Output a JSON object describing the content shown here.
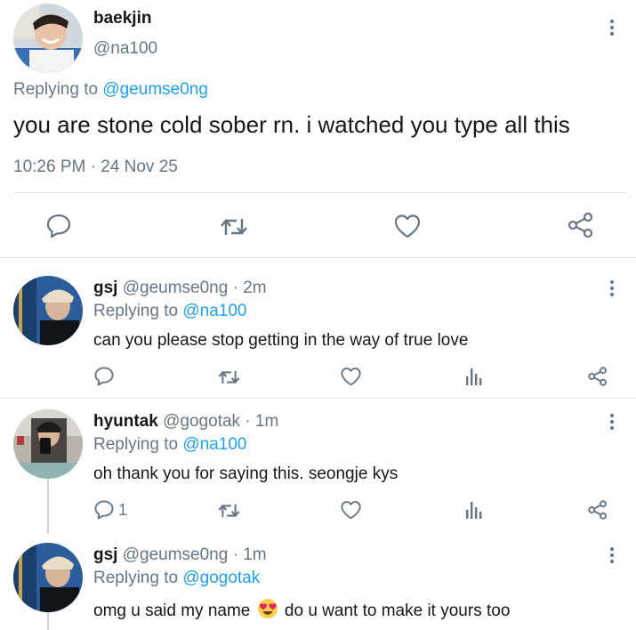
{
  "main_tweet": {
    "name": "baekjin",
    "handle": "@na100",
    "replying_prefix": "Replying to",
    "replying_to": "@geumse0ng",
    "text": "you are stone cold sober rn. i watched you type all this",
    "timestamp": "10:26 PM · 24 Nov 25",
    "actions": [
      "reply-icon",
      "retweet-icon",
      "like-icon",
      "share-icon"
    ]
  },
  "replies": [
    {
      "name": "gsj",
      "handle": "@geumse0ng",
      "time": "· 2m",
      "replying_prefix": "Replying to",
      "replying_to": "@na100",
      "text": "can you please stop getting in the way of true love",
      "reply_count": "",
      "actions": [
        "reply-icon",
        "retweet-icon",
        "like-icon",
        "analytics-icon",
        "share-icon"
      ]
    },
    {
      "name": "hyuntak",
      "handle": "@gogotak",
      "time": "· 1m",
      "replying_prefix": "Replying to",
      "replying_to": "@na100",
      "text": "oh thank you for saying this. seongje kys",
      "reply_count": "1",
      "actions": [
        "reply-icon",
        "retweet-icon",
        "like-icon",
        "analytics-icon",
        "share-icon"
      ]
    },
    {
      "name": "gsj",
      "handle": "@geumse0ng",
      "time": "· 1m",
      "replying_prefix": "Replying to",
      "replying_to": "@gogotak",
      "text_before_emoji": "omg u said my name",
      "emoji": "heart-eyes-emoji",
      "text_after_emoji": "do u want to make it yours too"
    }
  ],
  "colors": {
    "link": "#1da1f2",
    "secondary_text": "#657786",
    "primary_text": "#14171a",
    "divider": "#e1e8ed"
  }
}
